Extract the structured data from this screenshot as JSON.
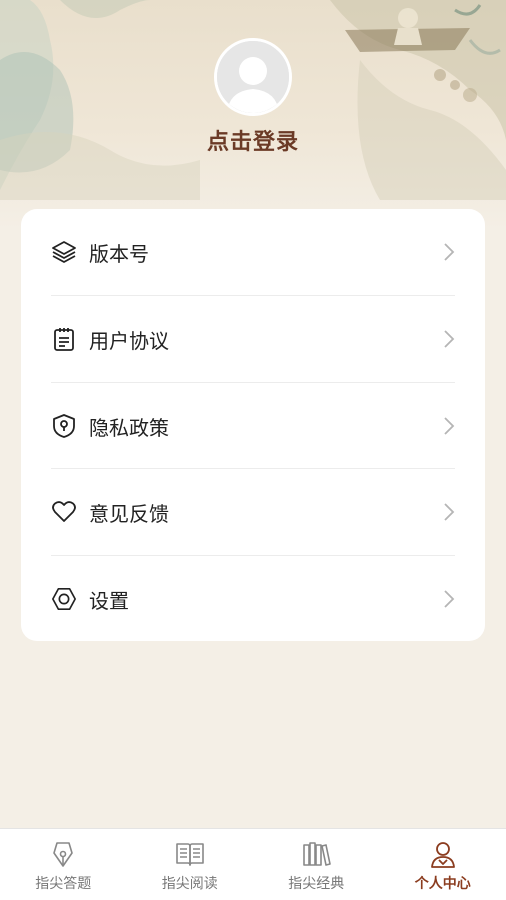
{
  "profile": {
    "login_text": "点击登录"
  },
  "menu": [
    {
      "label": "版本号",
      "icon": "layers-icon"
    },
    {
      "label": "用户协议",
      "icon": "clipboard-icon"
    },
    {
      "label": "隐私政策",
      "icon": "shield-lock-icon"
    },
    {
      "label": "意见反馈",
      "icon": "heart-icon"
    },
    {
      "label": "设置",
      "icon": "hexagon-settings-icon"
    }
  ],
  "tabbar": {
    "tabs": [
      {
        "label": "指尖答题",
        "icon": "pen-nib-icon",
        "active": false
      },
      {
        "label": "指尖阅读",
        "icon": "open-book-icon",
        "active": false
      },
      {
        "label": "指尖经典",
        "icon": "books-icon",
        "active": false
      },
      {
        "label": "个人中心",
        "icon": "person-icon",
        "active": true
      }
    ]
  },
  "colors": {
    "accent": "#8b3c1f",
    "login_text": "#6b3a26",
    "background": "#f4efe6",
    "card": "#ffffff"
  }
}
